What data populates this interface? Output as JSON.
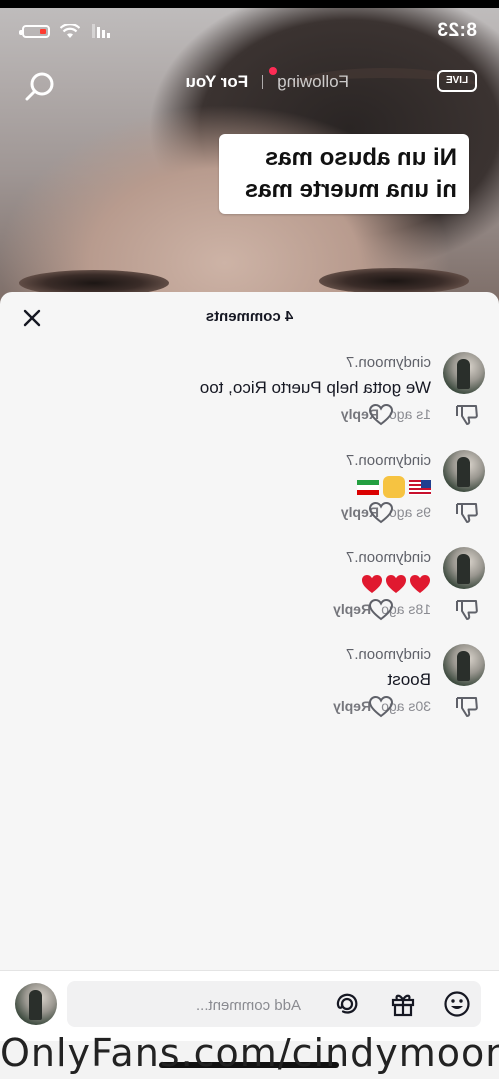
{
  "status_bar": {
    "time": "8:23"
  },
  "feed_header": {
    "live_label": "LIVE",
    "tabs": [
      {
        "label": "Following",
        "has_dot": true
      },
      {
        "label": "For You",
        "active": true
      }
    ]
  },
  "caption": {
    "line1": "Ni un abuso mas",
    "line2": "ni una muerte mas"
  },
  "comments_sheet": {
    "title": "4 comments",
    "comments": [
      {
        "username": "cindymoon.7",
        "text": "We gotta help Puerto Rico, too",
        "time": "1s ago",
        "reply_label": "Reply"
      },
      {
        "username": "cindymoon.7",
        "text": "",
        "time": "9s ago",
        "reply_label": "Reply"
      },
      {
        "username": "cindymoon.7",
        "text": "",
        "time": "18s ago",
        "reply_label": "Reply"
      },
      {
        "username": "cindymoon.7",
        "text": "Boost",
        "time": "30s ago",
        "reply_label": "Reply"
      }
    ]
  },
  "composer": {
    "placeholder": "Add comment..."
  },
  "watermark": "OnlyFans.com/cindymoon",
  "colors": {
    "accent": "#fe2c55",
    "heart": "#e0192f"
  }
}
